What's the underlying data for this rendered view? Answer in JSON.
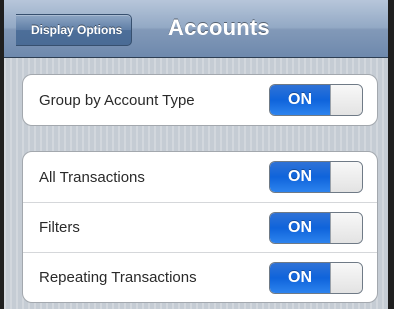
{
  "navbar": {
    "back_label": "Display Options",
    "title": "Accounts"
  },
  "group1": {
    "rows": [
      {
        "label": "Group by Account Type",
        "switch_label": "ON",
        "on": true
      }
    ]
  },
  "group2": {
    "rows": [
      {
        "label": "All Transactions",
        "switch_label": "ON",
        "on": true
      },
      {
        "label": "Filters",
        "switch_label": "ON",
        "on": true
      },
      {
        "label": "Repeating Transactions",
        "switch_label": "ON",
        "on": true
      }
    ]
  },
  "colors": {
    "switch_on": "#1a6ae0",
    "navbar": "#8299b8",
    "background": "#c5ccd4"
  }
}
